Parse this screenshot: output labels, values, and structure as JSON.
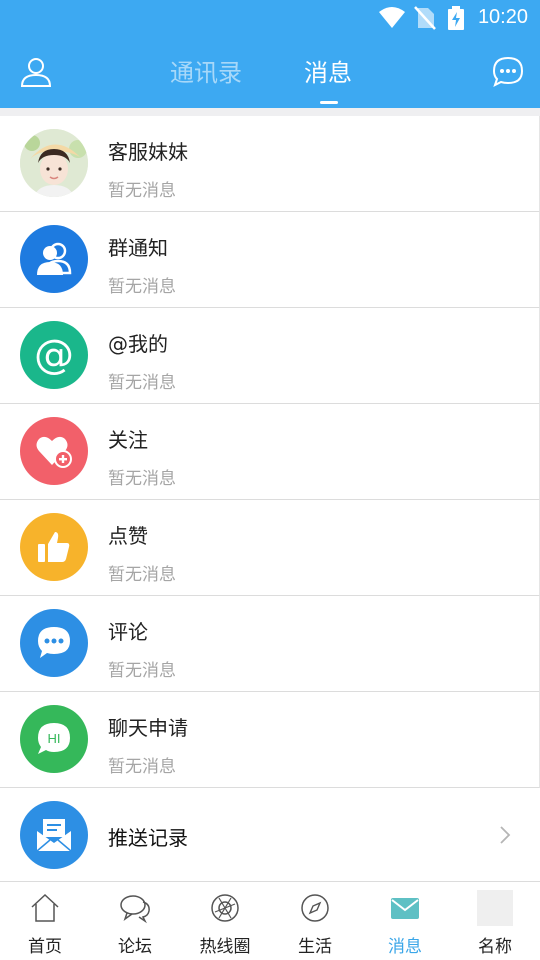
{
  "status_bar": {
    "time": "10:20"
  },
  "header": {
    "tabs": [
      {
        "label": "通讯录",
        "active": false
      },
      {
        "label": "消息",
        "active": true
      }
    ],
    "accent_color": "#3da9f2"
  },
  "messages": [
    {
      "title": "客服妹妹",
      "subtitle": "暂无消息",
      "icon": "avatar-photo"
    },
    {
      "title": "群通知",
      "subtitle": "暂无消息",
      "icon": "group-icon",
      "color": "#1e7be0"
    },
    {
      "title": "@我的",
      "subtitle": "暂无消息",
      "icon": "at-icon",
      "color": "#1ab78b"
    },
    {
      "title": "关注",
      "subtitle": "暂无消息",
      "icon": "heart-plus-icon",
      "color": "#f2606a"
    },
    {
      "title": "点赞",
      "subtitle": "暂无消息",
      "icon": "thumbs-up-icon",
      "color": "#f7b32b"
    },
    {
      "title": "评论",
      "subtitle": "暂无消息",
      "icon": "comment-icon",
      "color": "#2d8fe4"
    },
    {
      "title": "聊天申请",
      "subtitle": "暂无消息",
      "icon": "hi-bubble-icon",
      "color": "#35b85a"
    }
  ],
  "push_record": {
    "title": "推送记录",
    "icon": "mail-icon",
    "color": "#2d8fe4"
  },
  "bottom_nav": [
    {
      "label": "首页",
      "icon": "home-icon",
      "active": false
    },
    {
      "label": "论坛",
      "icon": "forum-icon",
      "active": false
    },
    {
      "label": "热线圈",
      "icon": "hotline-icon",
      "active": false
    },
    {
      "label": "生活",
      "icon": "compass-icon",
      "active": false
    },
    {
      "label": "消息",
      "icon": "message-mail-icon",
      "active": true
    },
    {
      "label": "名称",
      "icon": "placeholder-icon",
      "active": false
    }
  ]
}
